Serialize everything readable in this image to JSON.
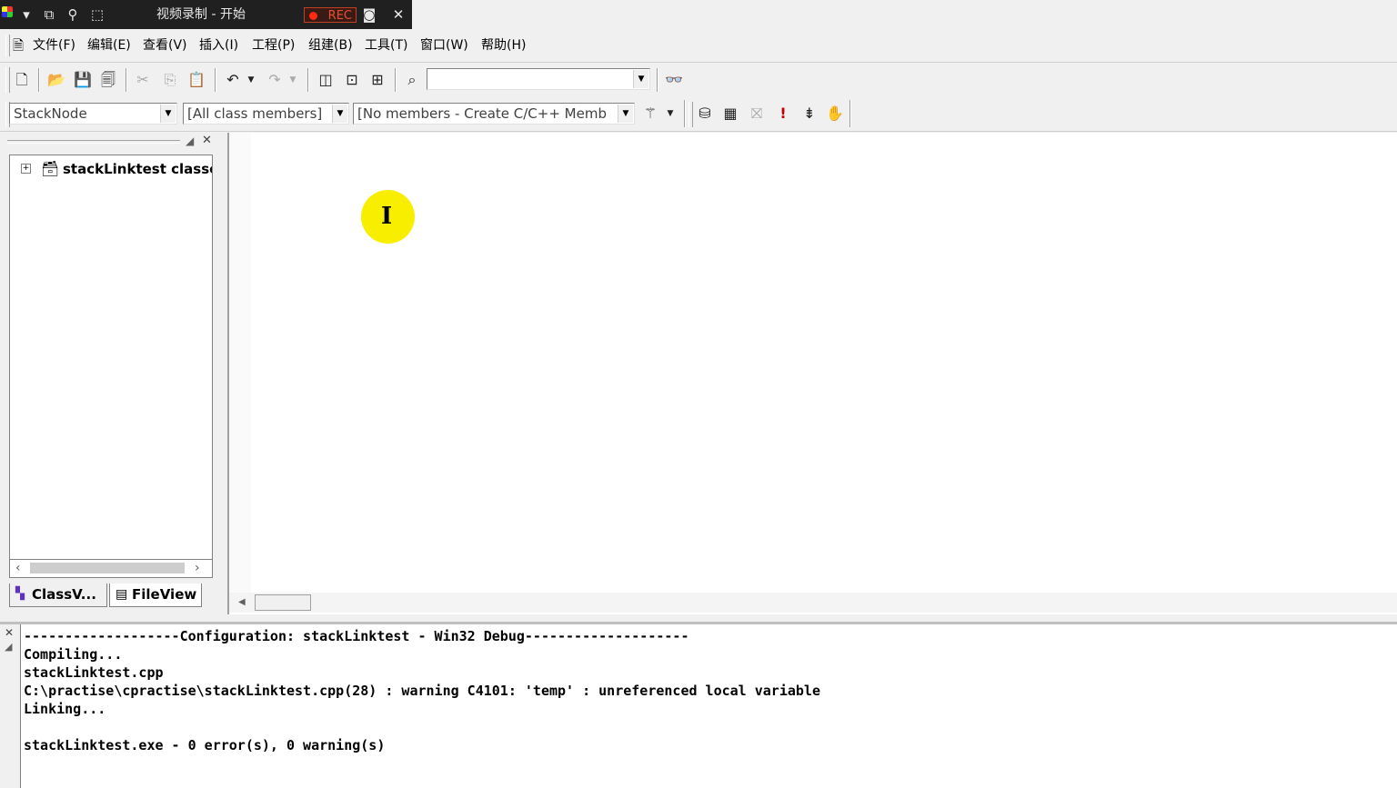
{
  "recorder": {
    "title": "视频录制 - 开始",
    "rec_label": "REC",
    "icons": [
      "dropdown-icon",
      "restore-icon",
      "zoom-icon",
      "region-icon",
      "camera-icon",
      "close-icon"
    ]
  },
  "menu": {
    "items": [
      "文件(F)",
      "编辑(E)",
      "查看(V)",
      "插入(I)",
      "工程(P)",
      "组建(B)",
      "工具(T)",
      "窗口(W)",
      "帮助(H)"
    ]
  },
  "toolbar": {
    "find_combo_value": ""
  },
  "wizardbar": {
    "class_combo": "StackNode",
    "filter_combo": "[All class members]",
    "members_combo": "[No members - Create C/C++ Memb"
  },
  "workspace": {
    "tree_root": "stackLinktest classes",
    "tabs": [
      "ClassV...",
      "FileView"
    ]
  },
  "output": {
    "lines": [
      "-------------------Configuration: stackLinktest - Win32 Debug--------------------",
      "Compiling...",
      "stackLinktest.cpp",
      "C:\\practise\\cpractise\\stackLinktest.cpp(28) : warning C4101: 'temp' : unreferenced local variable",
      "Linking...",
      "",
      "stackLinktest.exe - 0 error(s), 0 warning(s)"
    ]
  },
  "cursor": {
    "glyph": "I"
  }
}
